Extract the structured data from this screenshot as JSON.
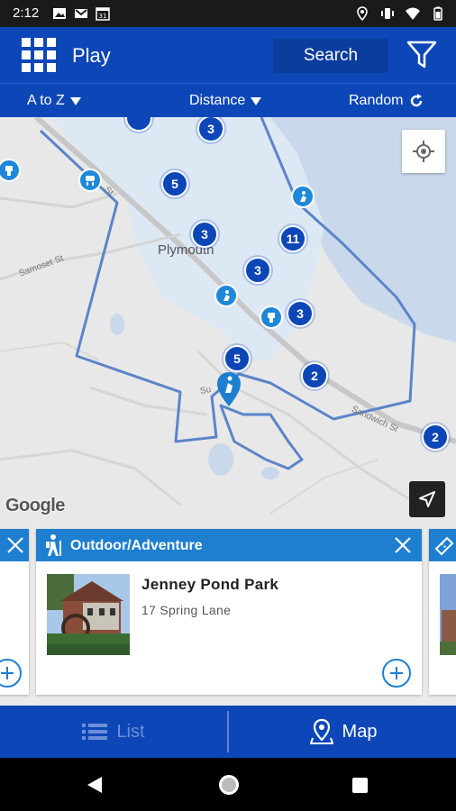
{
  "status_bar": {
    "time": "2:12",
    "left_icons": [
      "image-icon",
      "gmail-icon",
      "calendar-icon"
    ],
    "right_icons": [
      "location-icon",
      "vibrate-icon",
      "wifi-icon",
      "battery-icon"
    ]
  },
  "header": {
    "title": "Play",
    "search_label": "Search"
  },
  "sort_bar": {
    "a_to_z": "A to Z",
    "distance": "Distance",
    "random": "Random"
  },
  "map": {
    "town": "Plymouth",
    "streets": [
      "Samoset St",
      "Sandwich St",
      "St",
      "Su"
    ],
    "clusters": [
      "3",
      "5",
      "3",
      "11",
      "3",
      "3",
      "5",
      "2",
      "2"
    ],
    "attribution": "Google"
  },
  "card": {
    "category": "Outdoor/Adventure",
    "name": "Jenney Pond Park",
    "address": "17 Spring Lane"
  },
  "tabs": {
    "list_label": "List",
    "map_label": "Map"
  },
  "colors": {
    "primary": "#0d47b7",
    "accent": "#1e7fd0",
    "poi": "#1e88d8"
  }
}
